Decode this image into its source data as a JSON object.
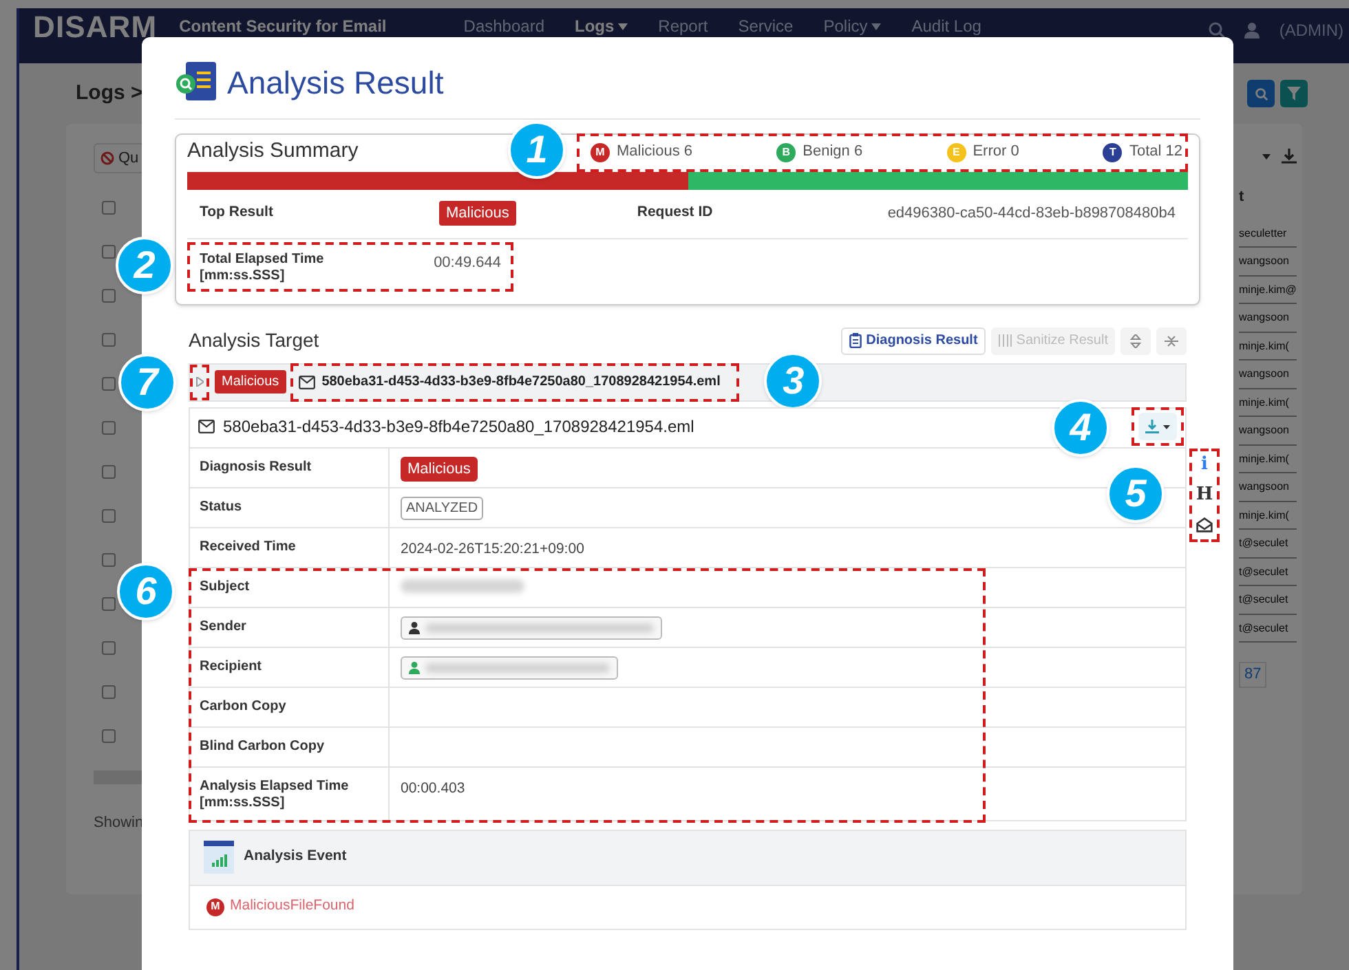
{
  "app": {
    "logo": "DISARM",
    "product": "Content Security for Email",
    "nav": [
      {
        "label": "Dashboard",
        "selected": false,
        "dropdown": false
      },
      {
        "label": "Logs",
        "selected": true,
        "dropdown": true
      },
      {
        "label": "Report",
        "selected": false,
        "dropdown": false
      },
      {
        "label": "Service",
        "selected": false,
        "dropdown": false
      },
      {
        "label": "Policy",
        "selected": false,
        "dropdown": true
      },
      {
        "label": "Audit Log",
        "selected": false,
        "dropdown": false
      }
    ],
    "user": "(ADMIN)",
    "breadcrumb": "Logs >",
    "quarantine_button": "Qu",
    "column_heading": "t",
    "row_checkboxes": [
      {
        "checked": false
      },
      {
        "checked": false
      },
      {
        "checked": false
      },
      {
        "checked": false
      },
      {
        "checked": false
      },
      {
        "checked": false
      },
      {
        "checked": false
      },
      {
        "checked": false
      },
      {
        "checked": false
      },
      {
        "checked": false
      },
      {
        "checked": false
      },
      {
        "checked": false
      },
      {
        "checked": false
      }
    ],
    "recipients": [
      "seculetter",
      "wangsoon",
      "minje.kim@",
      "wangsoon",
      "minje.kim(",
      "wangsoon",
      "minje.kim(",
      "wangsoon",
      "minje.kim(",
      "wangsoon",
      "minje.kim(",
      "t@seculet",
      "t@seculet",
      "t@seculet",
      "t@seculet"
    ],
    "footer": "Showin",
    "page": "87"
  },
  "modal": {
    "title": "Analysis Result",
    "summary": {
      "title": "Analysis Summary",
      "callout": "1",
      "counts": [
        {
          "badge": "M",
          "label": "Malicious 6",
          "color": "#c62828"
        },
        {
          "badge": "B",
          "label": "Benign 6",
          "color": "#2eaa5c"
        },
        {
          "badge": "E",
          "label": "Error 0",
          "color": "#f5c21b"
        },
        {
          "badge": "T",
          "label": "Total 12",
          "color": "#2b3f94"
        }
      ],
      "bar": {
        "level": 0.5
      },
      "top_result": {
        "label": "Top Result",
        "value": "Malicious"
      },
      "request_id": {
        "label": "Request ID",
        "value": "ed496380-ca50-44cd-83eb-b898708480b4"
      },
      "elapsed": {
        "label": "Total Elapsed Time [mm:ss.SSS]",
        "value": "00:49.644",
        "callout": "2"
      }
    },
    "target": {
      "title": "Analysis Target",
      "views": [
        {
          "label": "Diagnosis Result",
          "selected": true
        },
        {
          "label": "Sanitize Result",
          "selected": false
        }
      ],
      "item": {
        "expanded": false,
        "toggle_callout": "7",
        "result": "Malicious",
        "filename": "580eba31-d453-4d33-b3e9-8fb4e7250a80_1708928421954.eml",
        "callout": "3"
      },
      "detail": {
        "filename": "580eba31-d453-4d33-b3e9-8fb4e7250a80_1708928421954.eml",
        "download_callout": "4",
        "side_tools": [
          {
            "kind": "glyph",
            "glyph": "i",
            "color": "#2f80ed"
          },
          {
            "kind": "glyph",
            "glyph": "H",
            "color": "#333333"
          },
          {
            "kind": "mail"
          }
        ],
        "side_callout": "5",
        "rows": [
          {
            "label": "Diagnosis Result",
            "kind": "badge",
            "value": "Malicious"
          },
          {
            "label": "Status",
            "kind": "tag",
            "value": "ANALYZED"
          },
          {
            "label": "Received Time",
            "kind": "text",
            "value": "2024-02-26T15:20:21+09:00"
          }
        ],
        "mail_callout": "6",
        "mail_rows": [
          {
            "label": "Subject",
            "kind": "blurred"
          },
          {
            "label": "Sender",
            "kind": "person",
            "color": "#333333"
          },
          {
            "label": "Recipient",
            "kind": "person",
            "color": "#2eaa5c"
          },
          {
            "label": "Carbon Copy",
            "kind": "empty"
          },
          {
            "label": "Blind Carbon Copy",
            "kind": "empty"
          },
          {
            "label": "Analysis Elapsed Time [mm:ss.SSS]",
            "kind": "text",
            "value": "00:00.403"
          }
        ]
      },
      "events": {
        "title": "Analysis Event",
        "items": [
          {
            "badge": "M",
            "label": "MaliciousFileFound"
          }
        ]
      }
    }
  }
}
